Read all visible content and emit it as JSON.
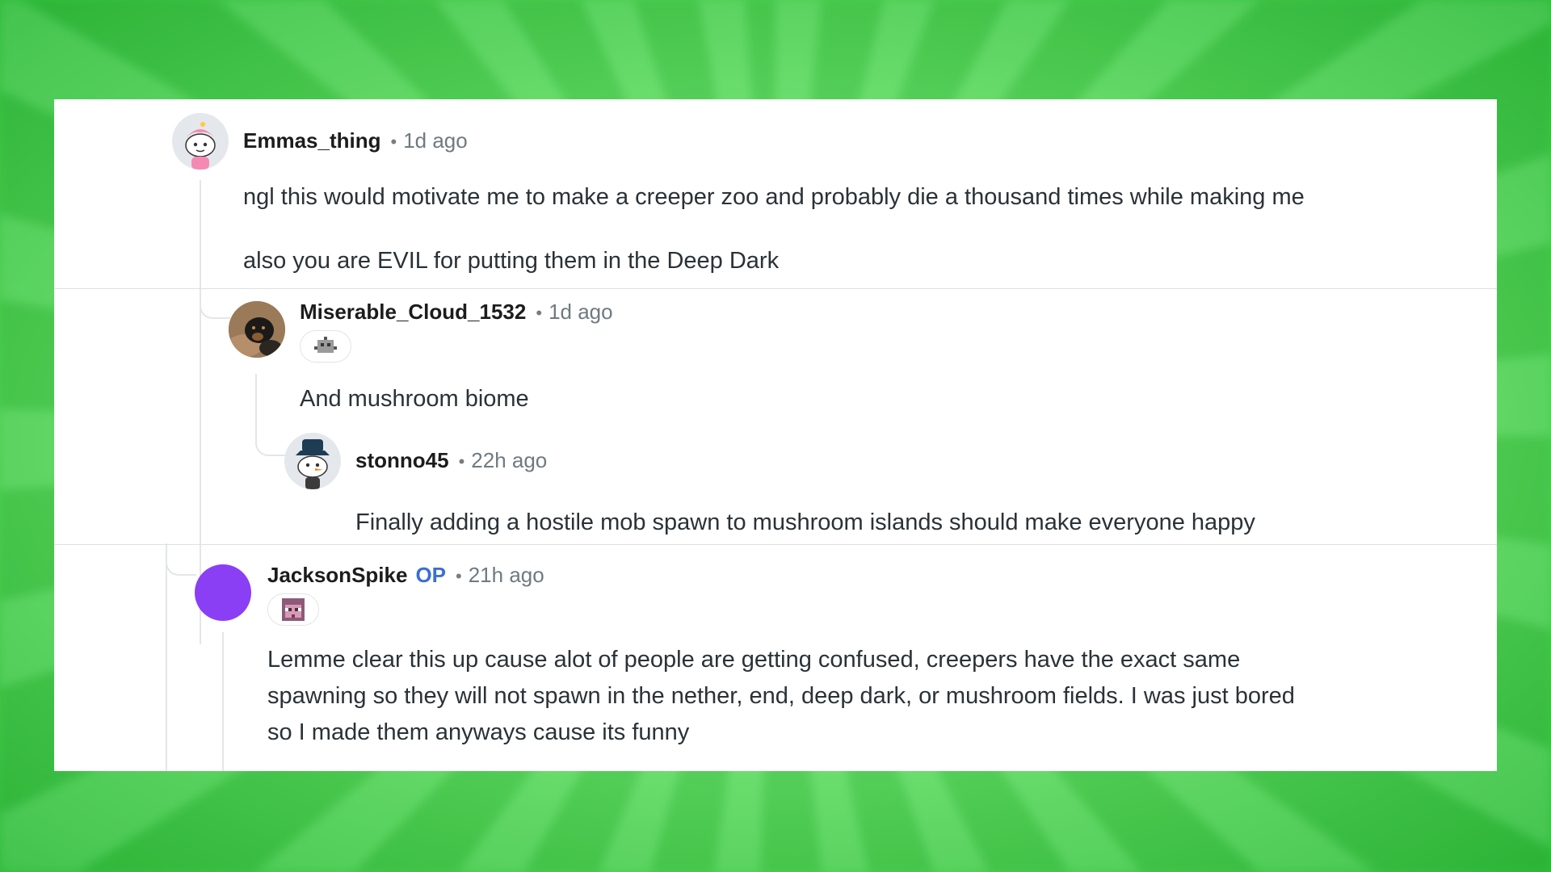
{
  "comments": [
    {
      "username": "Emmas_thing",
      "time": "1d ago",
      "paragraphs": [
        "ngl this would motivate me to make a creeper zoo and probably die a thousand times while making me",
        "also you are EVIL for putting them in the Deep Dark"
      ]
    },
    {
      "username": "Miserable_Cloud_1532",
      "time": "1d ago",
      "text": "And mushroom biome"
    },
    {
      "username": "stonno45",
      "time": "22h ago",
      "text": "Finally adding a hostile mob spawn to mushroom islands should make everyone happy"
    },
    {
      "username": "JacksonSpike",
      "op_label": "OP",
      "time": "21h ago",
      "lines": [
        "Lemme clear this up cause alot of people are getting confused, creepers have the exact same",
        "spawning so they will not spawn in the nether, end, deep dark, or mushroom fields. I was just bored",
        "so I made them anyways cause its funny"
      ]
    }
  ],
  "colors": {
    "avatar_purple": "#8a3ff5",
    "op": "#3b6fd0",
    "background_green": "#6fe872"
  },
  "icons": {
    "flair_1": "pixel-mob-icon",
    "flair_2": "pixel-face-icon"
  }
}
